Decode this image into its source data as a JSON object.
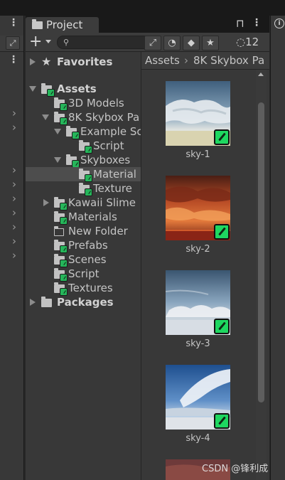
{
  "project_window": {
    "tab_label": "Project",
    "hidden_count": "12",
    "search_placeholder": ""
  },
  "tree": [
    {
      "label": "Favorites",
      "bold": true,
      "icon": "star-icon",
      "expanded": false
    },
    {
      "label": "Assets",
      "bold": true,
      "icon": "folder-icon",
      "expanded": true
    },
    {
      "label": "3D Models",
      "icon": "folder-icon"
    },
    {
      "label": "8K Skybox Pa",
      "icon": "folder-icon",
      "expanded": true
    },
    {
      "label": "Example Sc",
      "icon": "folder-icon",
      "expanded": true
    },
    {
      "label": "Script",
      "icon": "folder-icon"
    },
    {
      "label": "Skyboxes",
      "icon": "folder-icon",
      "expanded": true
    },
    {
      "label": "Material",
      "icon": "folder-icon",
      "selected": true
    },
    {
      "label": "Texture",
      "icon": "folder-icon"
    },
    {
      "label": "Kawaii Slime",
      "icon": "folder-icon",
      "expanded": false
    },
    {
      "label": "Materials",
      "icon": "folder-icon"
    },
    {
      "label": "New Folder",
      "icon": "empty-folder-icon"
    },
    {
      "label": "Prefabs",
      "icon": "folder-icon"
    },
    {
      "label": "Scenes",
      "icon": "folder-icon"
    },
    {
      "label": "Script",
      "icon": "folder-icon"
    },
    {
      "label": "Textures",
      "icon": "folder-icon"
    },
    {
      "label": "Packages",
      "bold": true,
      "icon": "folder-icon",
      "expanded": false
    }
  ],
  "breadcrumb": [
    "Assets",
    "8K Skybox Pa"
  ],
  "assets": [
    {
      "name": "sky-1"
    },
    {
      "name": "sky-2"
    },
    {
      "name": "sky-3"
    },
    {
      "name": "sky-4"
    }
  ],
  "watermark": "CSDN @锋利成",
  "colors": {
    "panel_bg": "#383838",
    "selection_bg": "#4d4d4d",
    "badge_green": "#1ed760"
  }
}
